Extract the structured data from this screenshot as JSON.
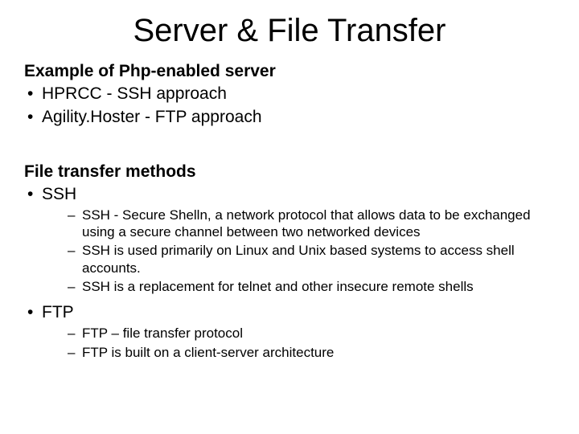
{
  "title": "Server & File Transfer",
  "section1": {
    "heading": "Example of Php-enabled server",
    "items": [
      "HPRCC - SSH approach",
      "Agility.Hoster - FTP approach"
    ]
  },
  "section2": {
    "heading": "File transfer methods",
    "items": [
      {
        "label": "SSH",
        "sub": [
          "SSH - Secure Shelln, a network protocol that allows data to be exchanged using a secure channel between two networked devices",
          "SSH is used primarily on Linux and Unix based systems to access shell accounts.",
          "SSH is a replacement for telnet and other insecure remote shells"
        ]
      },
      {
        "label": "FTP",
        "sub": [
          "FTP – file transfer protocol",
          "FTP is built on a client-server architecture"
        ]
      }
    ]
  }
}
